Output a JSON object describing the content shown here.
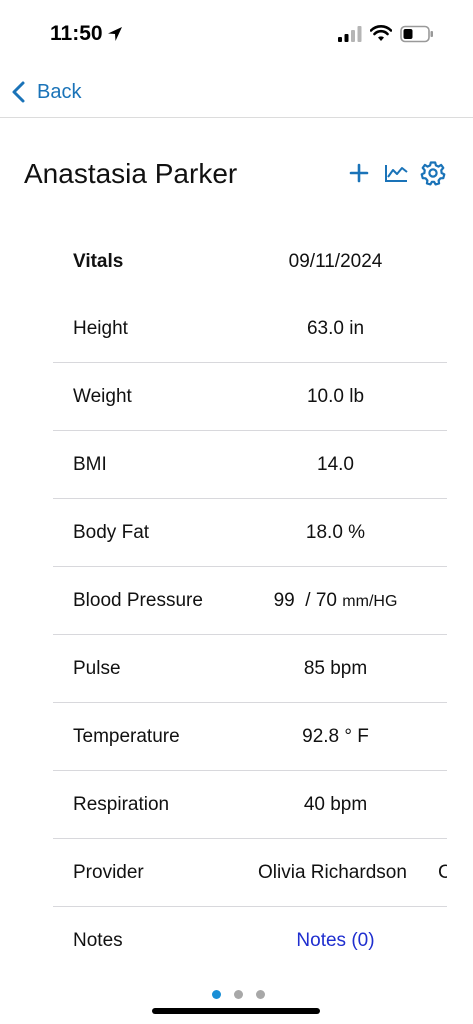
{
  "status_bar": {
    "time": "11:50",
    "icons": [
      "location-arrow-icon",
      "cellular-signal-icon",
      "wifi-icon",
      "battery-icon"
    ]
  },
  "nav": {
    "back_label": "Back",
    "back_icon": "chevron-left-icon"
  },
  "header": {
    "patient_name": "Anastasia Parker",
    "actions": [
      "add-icon",
      "chart-line-icon",
      "gear-icon"
    ]
  },
  "vitals": {
    "heading_label": "Vitals",
    "date": "09/11/2024",
    "rows": [
      {
        "label": "Height",
        "value": "63.0 in"
      },
      {
        "label": "Weight",
        "value": "10.0 lb"
      },
      {
        "label": "BMI",
        "value": "14.0"
      },
      {
        "label": "Body Fat",
        "value": "18.0 %"
      },
      {
        "label": "Blood Pressure",
        "value_text": "99  / 70",
        "unit": "mm/HG"
      },
      {
        "label": "Pulse",
        "value": "85 bpm"
      },
      {
        "label": "Temperature",
        "value": "92.8 ° F"
      },
      {
        "label": "Respiration",
        "value": "40 bpm"
      },
      {
        "label": "Provider",
        "value": "Olivia Richardson",
        "overflow": "C"
      },
      {
        "label": "Notes",
        "link": "Notes (0)"
      }
    ]
  },
  "pager": {
    "count": 3,
    "active_index": 0
  },
  "colors": {
    "accent": "#1a73b8",
    "link": "#1f2ecf",
    "divider": "#d8d8dc",
    "dot_active": "#1a8fd6",
    "dot_inactive": "#a8a8a8"
  }
}
